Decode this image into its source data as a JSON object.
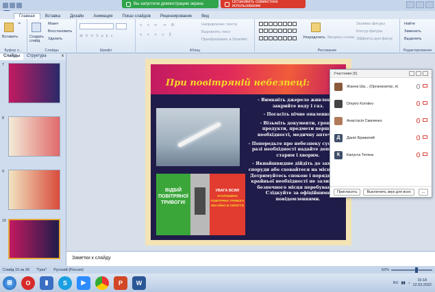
{
  "banners": {
    "screen_share": "Вы запустили демонстрацию экрана",
    "stop_share": "Остановить совместное использование"
  },
  "ribbon": {
    "tabs": [
      "Главная",
      "Вставка",
      "Дизайн",
      "Анимация",
      "Показ слайдов",
      "Рецензирование",
      "Вид"
    ],
    "clipboard": {
      "paste": "Вставить",
      "cut": "Макет",
      "copy": "Восстановить",
      "format": "Удалить",
      "create_slide": "Создать слайд",
      "label": "Буфер о..."
    },
    "slides_label": "Слайды",
    "font_label": "Шрифт",
    "paragraph": {
      "text_dir": "Направление текста",
      "align_text": "Выровнять текст",
      "smartart": "Преобразовать в SmartArt",
      "label": "Абзац"
    },
    "drawing": {
      "arrange": "Упорядочить",
      "quick_styles": "Экспресс-стили",
      "fill": "Заливка фигуры",
      "outline": "Контур фигуры",
      "effects": "Эффекты для фигур",
      "label": "Рисование"
    },
    "editing": {
      "find": "Найти",
      "replace": "Заменить",
      "select": "Выделить",
      "label": "Редактирование"
    }
  },
  "left_pane": {
    "tabs": [
      "Слайды",
      "Структура"
    ],
    "close": "x",
    "thumb_numbers": [
      "7",
      "8",
      "9",
      "10"
    ]
  },
  "slide": {
    "title": "При повітряній небезпеці:",
    "bullets": [
      "- Вимкніть джерело живлення, закрийте воду і газ.",
      "- Погасіть пічне опалення.",
      "- Візьміть документи, гроші і продукти, предмети першої необхідності, медичну аптечку.",
      "- Попередьте про небезпеку сусідів і в разі необхідності надайте допомогу старим і хворим.",
      "- Якнайшвидше дійдіть до захисної споруди або сховайтеся на місцевості. Дотримуйтесь спокою і порядку. Без крайньої необхідності не залишайте безпечного місця перебування. Слідкуйте за офіційними повідомленнями."
    ],
    "poster_left": "ВІДБІЙ ПОВІТРЯНОЇ ТРИВОГИ!",
    "poster_right": "УВАГА ВСІМ!",
    "poster_right_sub": "ОГОЛОШЕНА ПОВІТРЯНА ТРИВОГА НЕГАЙНО В УКРИТТЯ"
  },
  "notes": {
    "placeholder": "Заметки к слайду"
  },
  "status": {
    "slide": "Слайд 10 из 26",
    "theme": "\"Грех\"",
    "lang": "Русский (Россия)",
    "zoom": "62%",
    "zoom_fraction": 0.62
  },
  "participants": {
    "title": "Участники (5)",
    "list": [
      {
        "name": "Жанна Ша... (Организатор, я)",
        "initial": "",
        "color": "#8a5a3c",
        "mic_on": true
      },
      {
        "name": "Dmytro Korniiev",
        "initial": "",
        "color": "#444444",
        "mic_on": false
      },
      {
        "name": "Анастасія Смаченко",
        "initial": "",
        "color": "#b07a5a",
        "mic_on": false
      },
      {
        "name": "Даніл Брижатий",
        "initial": "Д",
        "color": "#3f4f6b",
        "mic_on": false
      },
      {
        "name": "Капуста Тетяна",
        "initial": "К",
        "color": "#3f4f6b",
        "mic_on": false
      }
    ],
    "invite": "Пригласить",
    "mute_all": "Выключить звук для всех",
    "more": "..."
  },
  "taskbar": {
    "lang": "RU",
    "time": "16:18",
    "date": "12.03.2022"
  }
}
